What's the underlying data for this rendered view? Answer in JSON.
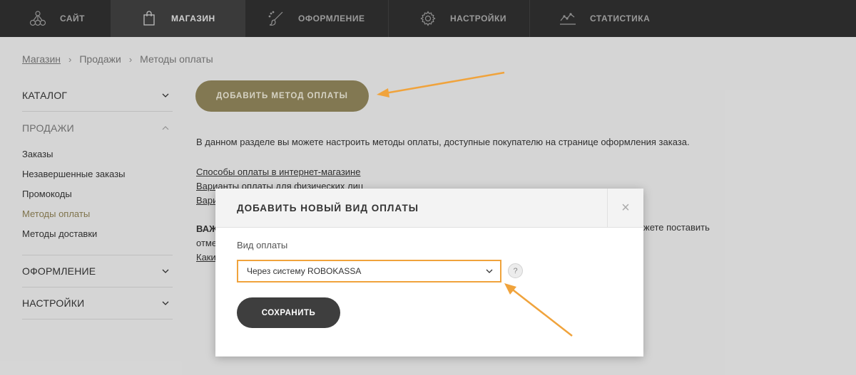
{
  "topnav": {
    "items": [
      {
        "label": "Сайт",
        "icon": "site-tree-icon"
      },
      {
        "label": "Магазин",
        "icon": "shopping-bag-icon",
        "active": true
      },
      {
        "label": "Оформление",
        "icon": "brush-icon"
      },
      {
        "label": "Настройки",
        "icon": "gear-icon"
      },
      {
        "label": "Статистика",
        "icon": "chart-icon"
      }
    ]
  },
  "breadcrumb": {
    "items": [
      "Магазин",
      "Продажи",
      "Методы оплаты"
    ],
    "separator": "›"
  },
  "sidebar": {
    "catalog": "Каталог",
    "sales": "Продажи",
    "sales_items": [
      "Заказы",
      "Незавершенные заказы",
      "Промокоды",
      "Методы оплаты",
      "Методы доставки"
    ],
    "active_item": "Методы оплаты",
    "design": "Оформление",
    "settings": "Настройки"
  },
  "main": {
    "add_button": "Добавить метод оплаты",
    "description": "В данном разделе вы можете настроить методы оплаты, доступные покупателю на странице оформления заказа.",
    "links": [
      "Способы оплаты в интернет-магазине",
      "Варианты оплаты для физических лиц",
      "Вари"
    ],
    "important_label": "ВАЖ",
    "important_line2": "отме",
    "important_line3": "Каки",
    "right_fragment": "жете поставить"
  },
  "modal": {
    "title": "Добавить новый вид оплаты",
    "close": "×",
    "field_label": "Вид оплаты",
    "select_value": "Через систему ROBOKASSA",
    "help": "?",
    "save_button": "Сохранить"
  },
  "colors": {
    "nav_bg": "#2b2b2b",
    "accent_gold": "#8e835a",
    "highlight_orange": "#f0a33c",
    "save_dark": "#3e3e3e"
  }
}
